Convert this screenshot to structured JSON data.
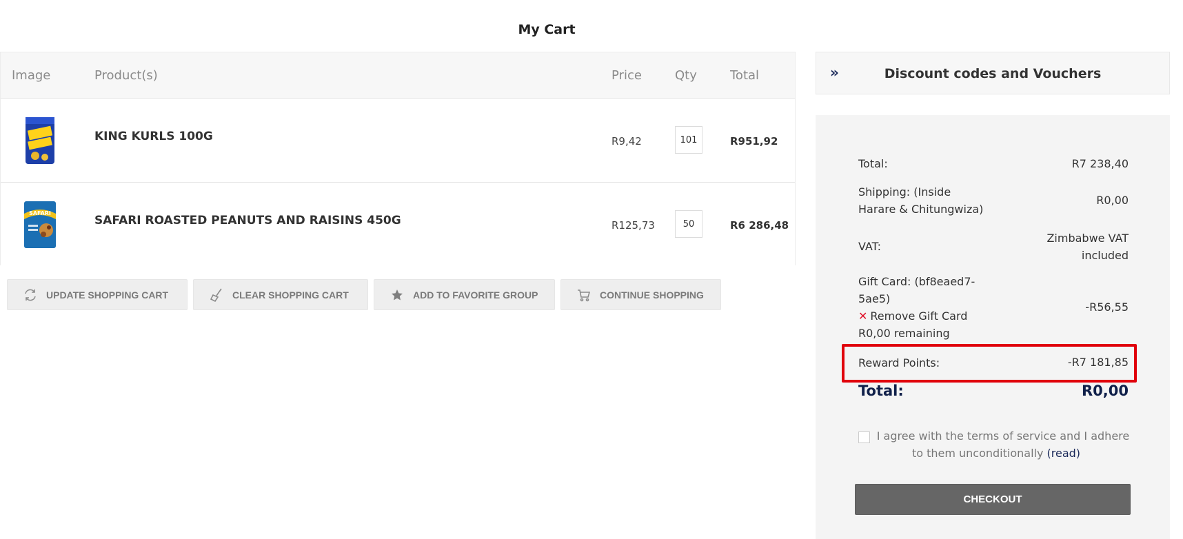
{
  "page": {
    "title": "My Cart"
  },
  "table": {
    "headers": {
      "image": "Image",
      "product": "Product(s)",
      "price": "Price",
      "qty": "Qty",
      "total": "Total"
    },
    "rows": [
      {
        "name": "KING KURLS 100G",
        "price": "R9,42",
        "qty": "101",
        "total": "R951,92",
        "image_icon": "king-kurls-pack"
      },
      {
        "name": "SAFARI ROASTED PEANUTS AND RAISINS 450G",
        "price": "R125,73",
        "qty": "50",
        "total": "R6 286,48",
        "image_icon": "safari-peanuts-pack"
      }
    ]
  },
  "actions": {
    "update": "UPDATE SHOPPING CART",
    "clear": "CLEAR SHOPPING CART",
    "favorite": "ADD TO FAVORITE GROUP",
    "continue": "CONTINUE SHOPPING"
  },
  "discount": {
    "chevron": "»",
    "title": "Discount codes and Vouchers"
  },
  "summary": {
    "total_label": "Total:",
    "total_value": "R7 238,40",
    "shipping_label_1": "Shipping: (Inside",
    "shipping_label_2": "Harare & Chitungwiza)",
    "shipping_value": "R0,00",
    "vat_label": "VAT:",
    "vat_value_1": "Zimbabwe VAT",
    "vat_value_2": "included",
    "gift_label_1": "Gift Card: (bf8eaed7-",
    "gift_label_2": "5ae5)",
    "gift_remove_x": "✕",
    "gift_remove": "Remove Gift Card",
    "gift_remaining": "R0,00 remaining",
    "gift_value": "-R56,55",
    "reward_label": "Reward Points:",
    "reward_value": "-R7 181,85",
    "grand_label": "Total:",
    "grand_value": "R0,00"
  },
  "terms": {
    "text_1": "I agree with the terms of service and I adhere",
    "text_2": "to them unconditionally",
    "read": "(read)"
  },
  "checkout": {
    "label": "CHECKOUT"
  },
  "colors": {
    "accent_navy": "#10204a",
    "highlight_red": "#e0000b",
    "remove_red": "#e0142b",
    "checkout_gray": "#666666"
  }
}
